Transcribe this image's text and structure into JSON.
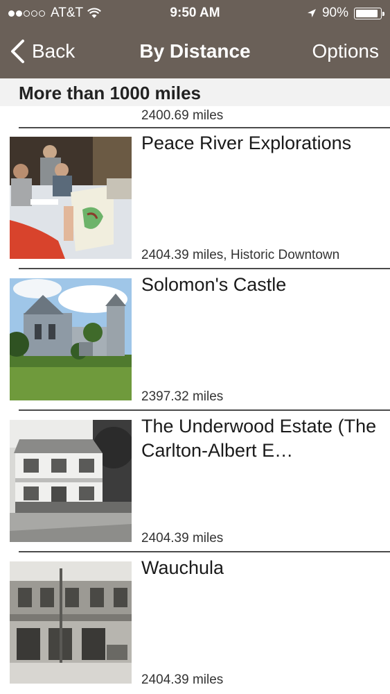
{
  "status_bar": {
    "carrier": "AT&T",
    "time": "9:50 AM",
    "battery": "90%",
    "battery_level": 0.9,
    "signal_dots": [
      true,
      true,
      false,
      false,
      false
    ]
  },
  "nav": {
    "back_label": "Back",
    "title": "By Distance",
    "options_label": "Options"
  },
  "section": {
    "header": "More than 1000 miles",
    "partial_item_distance": "2400.69 miles"
  },
  "items": [
    {
      "title": "Peace River Explorations",
      "distance": "2404.39 miles, Historic Downtown",
      "thumb_icon": "painting-class-photo"
    },
    {
      "title": "Solomon's Castle",
      "distance": "2397.32 miles",
      "thumb_icon": "castle-photo"
    },
    {
      "title": "The Underwood Estate (The Carlton-Albert E…",
      "distance": "2404.39 miles",
      "thumb_icon": "historic-house-photo"
    },
    {
      "title": "Wauchula",
      "distance": "2404.39 miles",
      "thumb_icon": "historic-building-photo"
    }
  ],
  "colors": {
    "nav_background": "#6a6058",
    "section_background": "#f2f2f2",
    "separator": "#4a4a4a"
  }
}
